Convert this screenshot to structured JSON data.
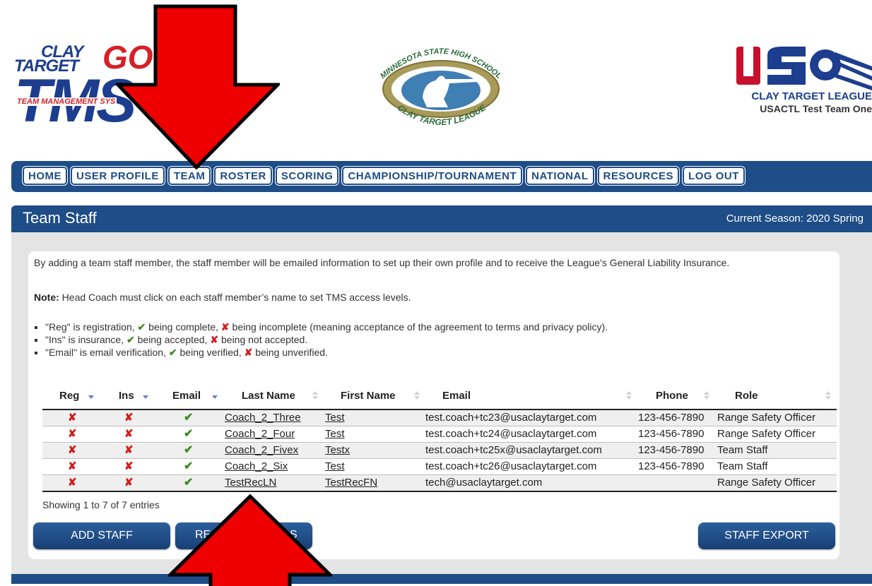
{
  "header": {
    "tms_logo": {
      "clay": "CLAY",
      "target": "TARGET",
      "go": "GO!",
      "tms": "TMS",
      "sub": "TEAM MANAGEMENT SYS"
    },
    "center_logo": {
      "top": "MINNESOTA STATE HIGH SCHOOL",
      "bottom": "CLAY TARGET LEAGUE"
    },
    "right_logo": {
      "line1": "CLAY TARGET LEAGUE",
      "line2": "USACTL Test Team One"
    }
  },
  "nav": [
    "HOME",
    "USER PROFILE",
    "TEAM",
    "ROSTER",
    "SCORING",
    "CHAMPIONSHIP/TOURNAMENT",
    "NATIONAL",
    "RESOURCES",
    "LOG OUT"
  ],
  "panel": {
    "title": "Team Staff",
    "season": "Current Season: 2020 Spring"
  },
  "intro": "By adding a team staff member, the staff member will be emailed information to set up their own profile and to receive the League's General Liability Insurance.",
  "note": {
    "label": "Note:",
    "text": " Head Coach must click on each staff member’s name to set TMS access levels."
  },
  "bullets": [
    {
      "pre": "\"Reg\" is registration, ",
      "mid": " being complete, ",
      "post": " being incomplete (meaning acceptance of the agreement to terms and privacy policy)."
    },
    {
      "pre": "\"Ins\" is insurance, ",
      "mid": " being accepted, ",
      "post": " being not accepted."
    },
    {
      "pre": "\"Email\" is email verification, ",
      "mid": " being verified, ",
      "post": " being unverified."
    }
  ],
  "table": {
    "columns": [
      "Reg",
      "Ins",
      "Email",
      "Last Name",
      "First Name",
      "Email",
      "Phone",
      "Role"
    ],
    "rows": [
      {
        "reg": "✘",
        "ins": "✘",
        "email_ok": "✔",
        "last": "Coach_2_Three",
        "first": "Test",
        "email": "test.coach+tc23@usaclaytarget.com",
        "phone": "123-456-7890",
        "role": "Range Safety Officer"
      },
      {
        "reg": "✘",
        "ins": "✘",
        "email_ok": "✔",
        "last": "Coach_2_Four",
        "first": "Test",
        "email": "test.coach+tc24@usaclaytarget.com",
        "phone": "123-456-7890",
        "role": "Range Safety Officer"
      },
      {
        "reg": "✘",
        "ins": "✘",
        "email_ok": "✔",
        "last": "Coach_2_Fivex",
        "first": "Testx",
        "email": "test.coach+tc25x@usaclaytarget.com",
        "phone": "123-456-7890",
        "role": "Team Staff"
      },
      {
        "reg": "✘",
        "ins": "✘",
        "email_ok": "✔",
        "last": "Coach_2_Six",
        "first": "Test",
        "email": "test.coach+tc26@usaclaytarget.com",
        "phone": "123-456-7890",
        "role": "Team Staff"
      },
      {
        "reg": "✘",
        "ins": "✘",
        "email_ok": "✔",
        "last": "TestRecLN",
        "first": "TestRecFN",
        "email": "tech@usaclaytarget.com",
        "phone": "",
        "role": "Range Safety Officer"
      }
    ],
    "entries": "Showing 1 to 7 of 7 entries"
  },
  "buttons": {
    "add_staff": "ADD STAFF",
    "second_visible": "RE",
    "second_tail": "S",
    "staff_export": "STAFF EXPORT"
  },
  "colors": {
    "navy": "#1e4d87",
    "arrow_red": "#ee0000",
    "check_green": "#3d8c1f",
    "cross_red": "#d31b1b"
  }
}
